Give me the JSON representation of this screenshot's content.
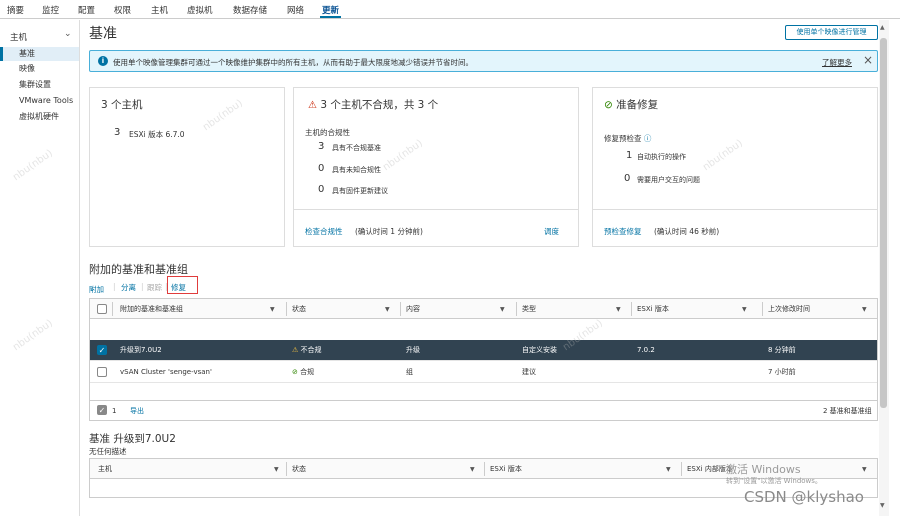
{
  "topnav": [
    "摘要",
    "监控",
    "配置",
    "权限",
    "主机",
    "虚拟机",
    "数据存储",
    "网络",
    "更新"
  ],
  "topnav_active": "更新",
  "sidebar": {
    "header": "主机",
    "items": [
      "基准",
      "映像",
      "集群设置",
      "VMware Tools",
      "虚拟机硬件"
    ]
  },
  "page": {
    "title": "基准",
    "image_button": "使用单个映像进行管理"
  },
  "banner": {
    "message": "使用单个映像管理集群可通过一个映像维护集群中的所有主机，从而有助于最大限度地减少错误并节省时间。",
    "learn_more": "了解更多"
  },
  "card_hosts": {
    "title": "3 个主机",
    "count": "3",
    "text": "ESXi 版本 6.7.0"
  },
  "card_compliance": {
    "title": "3 个主机不合规，共 3 个",
    "subtitle": "主机的合规性",
    "rows": [
      {
        "num": "3",
        "label": "具有不合规基准"
      },
      {
        "num": "0",
        "label": "具有未知合规性"
      },
      {
        "num": "0",
        "label": "具有固件更新建议"
      }
    ],
    "check_link": "检查合规性",
    "check_time": "(确认时间 1 分钟前)",
    "schedule": "调度"
  },
  "card_ready": {
    "title": "准备修复",
    "subtitle": "修复预检查",
    "rows": [
      {
        "num": "1",
        "label": "自动执行的操作"
      },
      {
        "num": "0",
        "label": "需要用户交互的问题"
      }
    ],
    "precheck_link": "预检查修复",
    "precheck_time": "(确认时间 46 秒前)"
  },
  "attached": {
    "title": "附加的基准和基准组",
    "toolbar": {
      "attach": "附加",
      "detach": "分离",
      "sync": "跟踪",
      "remediate": "修复"
    },
    "columns": [
      "附加的基准和基准组",
      "状态",
      "内容",
      "类型",
      "ESXi 版本",
      "上次修改时间"
    ],
    "rows": [
      {
        "name": "升级到7.0U2",
        "status": "不合规",
        "content": "升级",
        "type": "自定义安装",
        "esxi": "7.0.2",
        "modified": "8 分钟前",
        "selected": true
      },
      {
        "name": "vSAN Cluster 'senge-vsan'",
        "status": "合规",
        "content": "组",
        "type": "建议",
        "esxi": "",
        "modified": "7 小时前",
        "selected": false
      }
    ],
    "footer_count": "1",
    "export": "导出",
    "footer_total": "2 基准和基准组"
  },
  "baseline_detail": {
    "title": "基准 升级到7.0U2",
    "description": "无任何描述",
    "columns": [
      "主机",
      "状态",
      "ESXi 版本",
      "ESXi 内部版本"
    ]
  },
  "overlay": {
    "activate": "激活 Windows",
    "activate_sub": "转到\"设置\"以激活 Windows。",
    "csdn": "CSDN @klyshao",
    "watermark": "nbu(nbu)"
  }
}
